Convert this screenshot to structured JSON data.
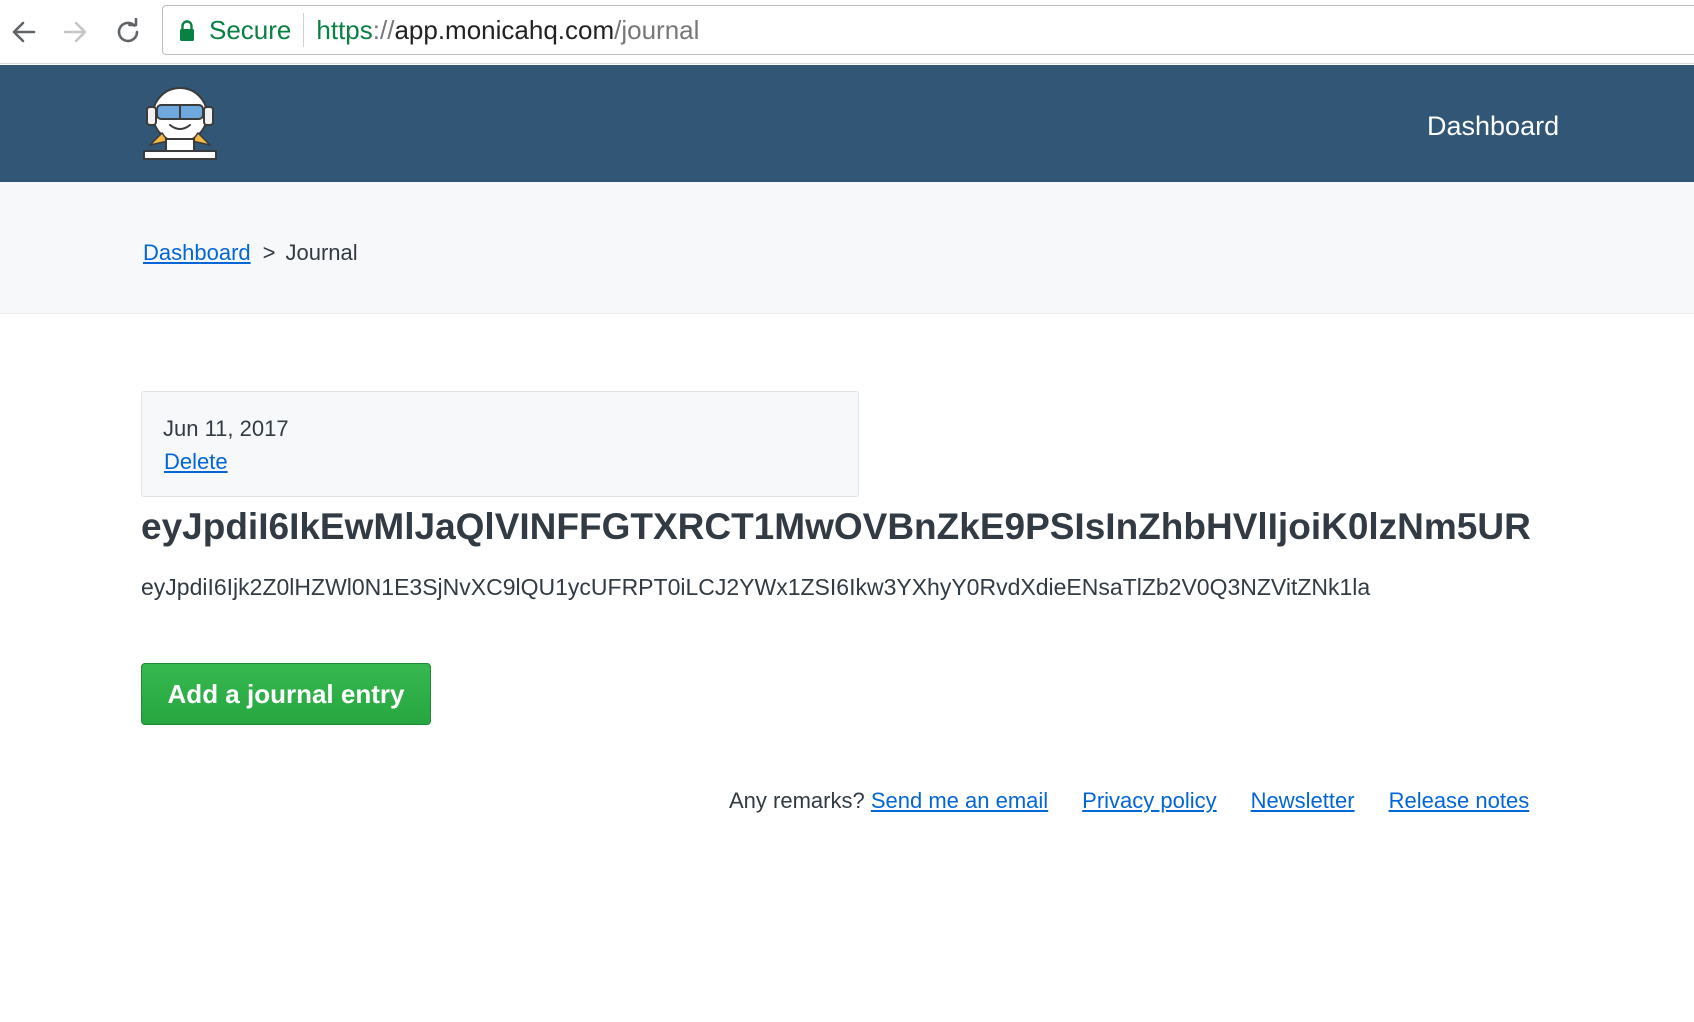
{
  "browser": {
    "secure_label": "Secure",
    "url": {
      "scheme": "https",
      "separator": "://",
      "host": "app.monicahq.com",
      "path": "/journal"
    },
    "icons": {
      "back": "arrow-left-icon",
      "forward": "arrow-right-icon",
      "reload": "reload-icon",
      "lock": "lock-icon"
    }
  },
  "header": {
    "logo": "monica-logo",
    "nav_dashboard": "Dashboard",
    "background": "#325776"
  },
  "breadcrumb": {
    "root": "Dashboard",
    "separator": ">",
    "current": "Journal"
  },
  "journal": {
    "entries": [
      {
        "date": "Jun 11, 2017",
        "delete_label": "Delete",
        "title": "eyJpdiI6IkEwMlJaQlVINFFGTXRCT1MwOVBnZkE9PSIsInZhbHVlIjoiK0lzNm5UR",
        "body": "eyJpdiI6Ijk2Z0lHZWl0N1E3SjNvXC9lQU1ycUFRPT0iLCJ2YWx1ZSI6Ikw3YXhyY0RvdXdieENsaTlZb2V0Q3NZVitZNk1la"
      }
    ],
    "add_button_label": "Add a journal entry",
    "accent_color": "#27a640"
  },
  "footer": {
    "remarks_label": "Any remarks?",
    "links": {
      "email": "Send me an email",
      "privacy": "Privacy policy",
      "newsletter": "Newsletter",
      "release_notes": "Release notes"
    },
    "link_color": "#0366d6"
  }
}
